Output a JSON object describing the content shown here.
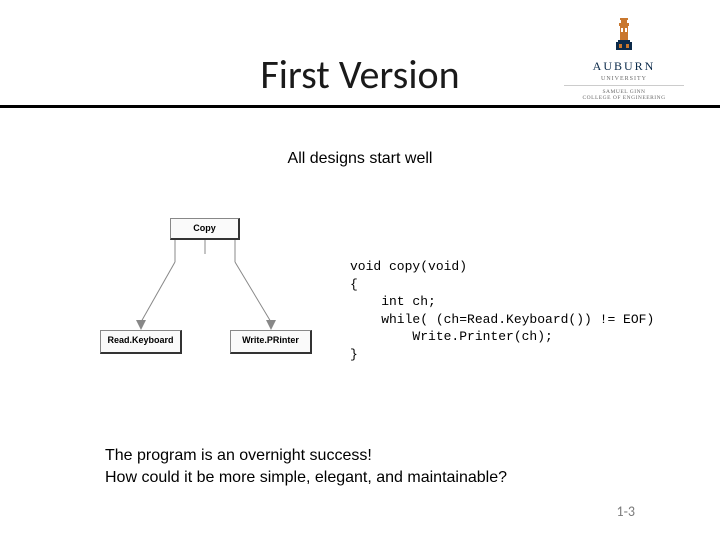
{
  "logo": {
    "name": "AUBURN",
    "sub": "UNIVERSITY",
    "dept1": "SAMUEL GINN",
    "dept2": "COLLEGE OF ENGINEERING"
  },
  "title": "First Version",
  "subtitle": "All designs start well",
  "diagram": {
    "top": "Copy",
    "left": "Read.Keyboard",
    "right": "Write.PRinter"
  },
  "code": {
    "l1": "void copy(void)",
    "l2": "{",
    "l3": "    int ch;",
    "l4": "    while( (ch=Read.Keyboard()) != EOF)",
    "l5": "        Write.Printer(ch);",
    "l6": "}"
  },
  "footer": {
    "line1": "The program is an overnight success!",
    "line2": "How could it be more simple, elegant, and maintainable?"
  },
  "page": "1-3"
}
